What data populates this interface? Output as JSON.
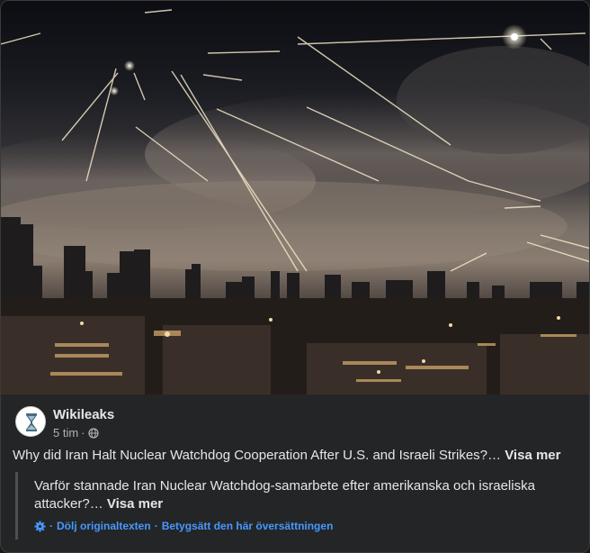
{
  "post": {
    "page_name": "Wikileaks",
    "time": "5 tim",
    "separator": "·",
    "privacy_icon": "globe-icon",
    "text": "Why did Iran Halt Nuclear Watchdog Cooperation After U.S. and Israeli Strikes?…",
    "see_more": "Visa mer"
  },
  "translation": {
    "text": "Varför stannade Iran Nuclear Watchdog-samarbete efter amerikanska och israeliska attacker?…",
    "see_more": "Visa mer",
    "icon": "gear-icon",
    "lead_sep": "·",
    "hide_original": "Dölj originaltexten",
    "mid_sep": "·",
    "rate_translation": "Betygsätt den här översättningen"
  },
  "colors": {
    "card_bg": "#242526",
    "text": "#e4e6eb",
    "muted": "#b0b3b8",
    "link": "#4599ff"
  }
}
